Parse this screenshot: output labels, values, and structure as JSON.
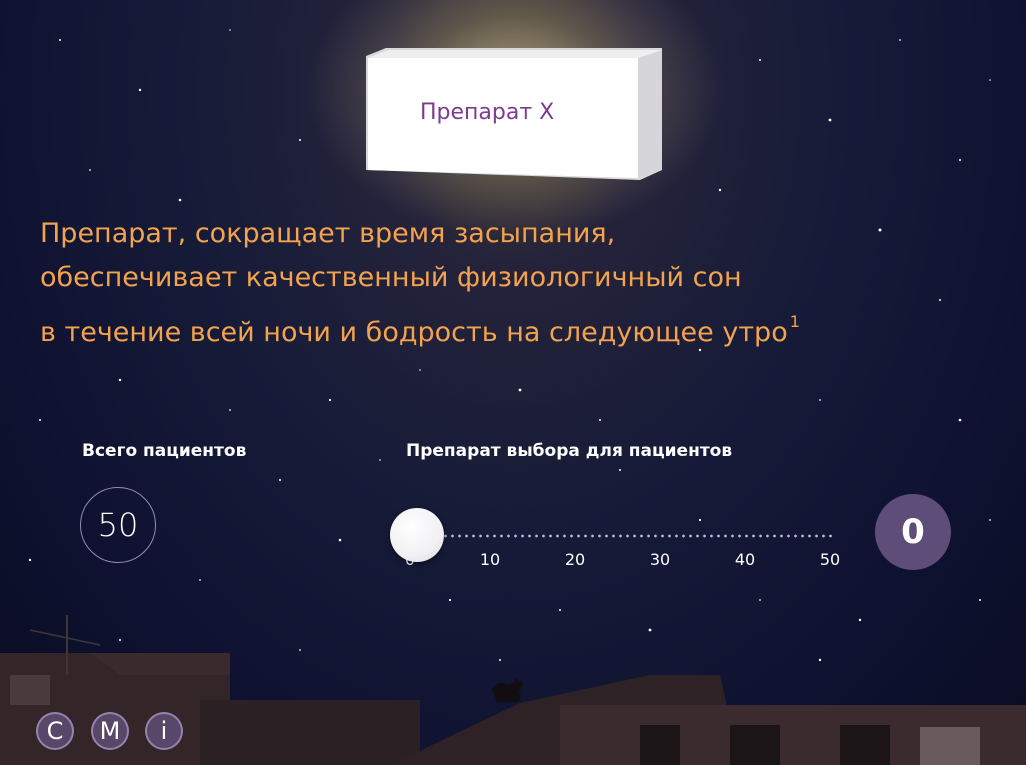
{
  "product": {
    "name": "Препарат X"
  },
  "headline": {
    "line1": "Препарат, сокращает время засыпания,",
    "line2": "обеспечивает качественный физиологичный сон",
    "line3": "в течение всей ночи и бодрость на следующее утро",
    "footnote": "1"
  },
  "total_patients": {
    "label": "Всего пациентов",
    "value": "50"
  },
  "choice": {
    "label": "Препарат выбора для пациентов",
    "slider_value": 0,
    "slider_max": 50,
    "ticks": [
      "0",
      "10",
      "20",
      "30",
      "40",
      "50"
    ],
    "result": "0"
  },
  "bottom_buttons": [
    "C",
    "M",
    "i"
  ],
  "colors": {
    "headline": "#f3a24d",
    "accent": "#5e4d79",
    "product_label": "#7b3b8f"
  }
}
